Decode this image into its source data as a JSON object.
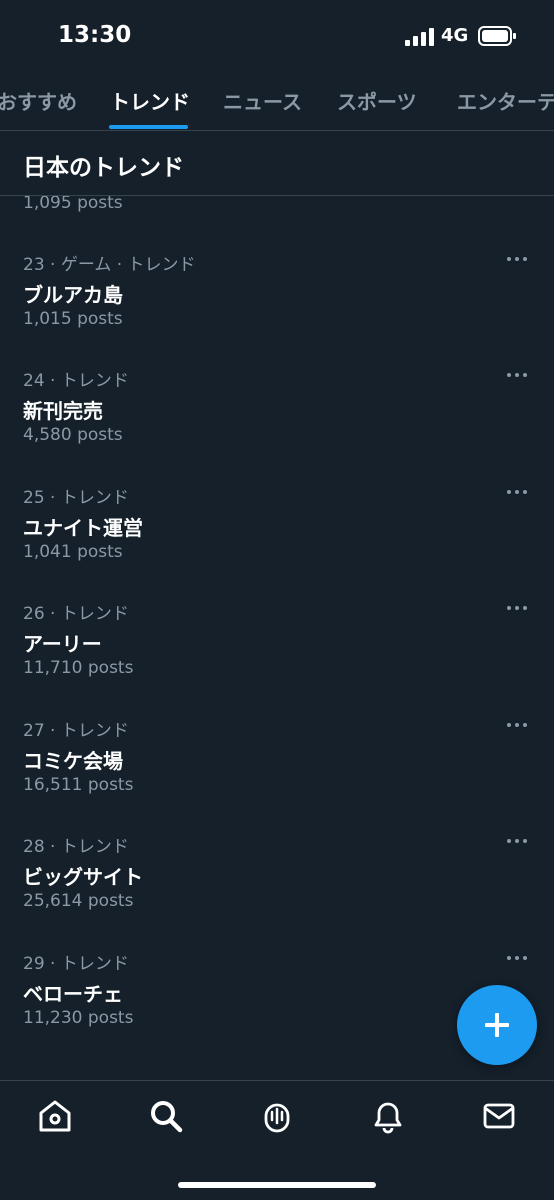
{
  "status": {
    "time": "13:30",
    "network": "4G"
  },
  "tabs": [
    {
      "label": "おすすめ",
      "active": false
    },
    {
      "label": "トレンド",
      "active": true
    },
    {
      "label": "ニュース",
      "active": false
    },
    {
      "label": "スポーツ",
      "active": false
    },
    {
      "label": "エンターテ",
      "active": false
    }
  ],
  "section": {
    "title": "日本のトレンド"
  },
  "partial_count": "1,095 posts",
  "trends": [
    {
      "meta": "23 · ゲーム · トレンド",
      "name": "ブルアカ島",
      "count": "1,015 posts"
    },
    {
      "meta": "24 · トレンド",
      "name": "新刊完売",
      "count": "4,580 posts"
    },
    {
      "meta": "25 · トレンド",
      "name": "ユナイト運営",
      "count": "1,041 posts"
    },
    {
      "meta": "26 · トレンド",
      "name": "アーリー",
      "count": "11,710 posts"
    },
    {
      "meta": "27 · トレンド",
      "name": "コミケ会場",
      "count": "16,511 posts"
    },
    {
      "meta": "28 · トレンド",
      "name": "ビッグサイト",
      "count": "25,614 posts"
    },
    {
      "meta": "29 · トレンド",
      "name": "ベローチェ",
      "count": "11,230 posts"
    }
  ],
  "icons": {
    "fab": "plus-icon",
    "nav": [
      "home-icon",
      "search-icon",
      "spaces-icon",
      "bell-icon",
      "mail-icon"
    ]
  },
  "colors": {
    "background": "#15202b",
    "accent": "#1d9bf0",
    "secondary_text": "#8b98a5",
    "divider": "#38444d"
  }
}
